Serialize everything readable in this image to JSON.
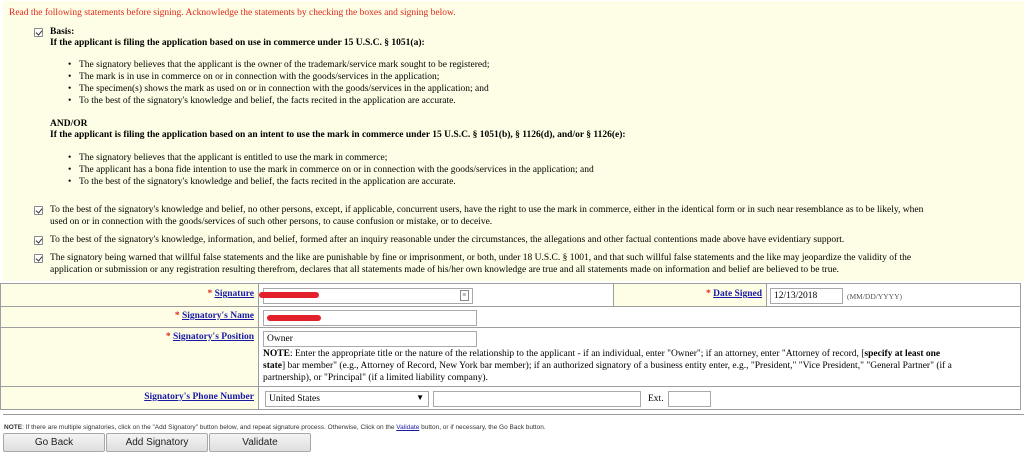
{
  "intro": "Read the following statements before signing. Acknowledge the statements by checking the boxes and signing below.",
  "basis": {
    "heading": "Basis:",
    "use_heading": "If the applicant is filing the application based on use in commerce under 15 U.S.C. § 1051(a):",
    "use_bullets": [
      "The signatory believes that the applicant is the owner of the trademark/service mark sought to be registered;",
      "The mark is in use in commerce on or in connection with the goods/services in the application;",
      "The specimen(s) shows the mark as used on or in connection with the goods/services in the application; and",
      "To the best of the signatory's knowledge and belief, the facts recited in the application are accurate."
    ],
    "andor": "AND/OR",
    "intent_heading": "If the applicant is filing the application based on an intent to use the mark in commerce under 15 U.S.C. § 1051(b), § 1126(d), and/or § 1126(e):",
    "intent_bullets": [
      "The signatory believes that the applicant is entitled to use the mark in commerce;",
      "The applicant has a bona fide intention to use the mark in commerce on or in connection with the goods/services in the application; and",
      "To the best of the signatory's knowledge and belief, the facts recited in the application are accurate."
    ]
  },
  "statements": [
    {
      "line1": "To the best of the signatory's knowledge and belief, no other persons, except, if applicable, concurrent users, have the right to use the mark in commerce, either in the identical form or in such near resemblance as to be likely, when",
      "line2": "used on or in connection with the goods/services of such other persons, to cause confusion or mistake, or to deceive."
    },
    {
      "line1": "To the best of the signatory's knowledge, information, and belief, formed after an inquiry reasonable under the circumstances, the allegations and other factual contentions made above have evidentiary support.",
      "line2": ""
    },
    {
      "line1": "The signatory being warned that willful false statements and the like are punishable by fine or imprisonment, or both, under 18 U.S.C. § 1001, and that such willful false statements and the like may jeopardize the validity of the",
      "line2": "application or submission or any registration resulting therefrom, declares that all statements made of his/her own knowledge are true and all statements made on information and belief are believed to be true."
    }
  ],
  "form": {
    "required_mark": "*",
    "signature_label": "Signature",
    "date_signed_label": "Date Signed",
    "date_signed_value": "12/13/2018",
    "date_format_hint": "(MM/DD/YYYY)",
    "signatory_name_label": "Signatory's Name",
    "signatory_position_label": "Signatory's Position",
    "signatory_position_value": "Owner",
    "note_prefix": "NOTE",
    "note_line1": ": Enter the appropriate title or the nature of the relationship to the applicant - if an individual, enter \"Owner\"; if an attorney, enter \"Attorney of record, [",
    "note_bold": "specify at least one",
    "note_line2_bold": "state",
    "note_line2": "] bar member\" (e.g., Attorney of Record, New York bar member); if an authorized signatory of a business entity enter, e.g., \"President,\" \"Vice President,\" \"General Partner\" (if a",
    "note_line3": "partnership), or \"Principal\" (if a limited liability company).",
    "phone_label": "Signatory's Phone Number",
    "country_value": "United States",
    "ext_label": "Ext."
  },
  "footnote": {
    "prefix": "NOTE",
    "text": ": If there are multiple signatories, click on the \"Add Signatory\" button below, and repeat signature process. Otherwise, Click on the ",
    "link": "Validate",
    "suffix": " button, or if necessary, the Go Back button."
  },
  "buttons": {
    "go_back": "Go Back",
    "add_signatory": "Add Signatory",
    "validate": "Validate"
  },
  "colors": {
    "panel_bg": "#fefee6",
    "required_red": "#e0271b",
    "link_blue": "#1a1aa6"
  }
}
